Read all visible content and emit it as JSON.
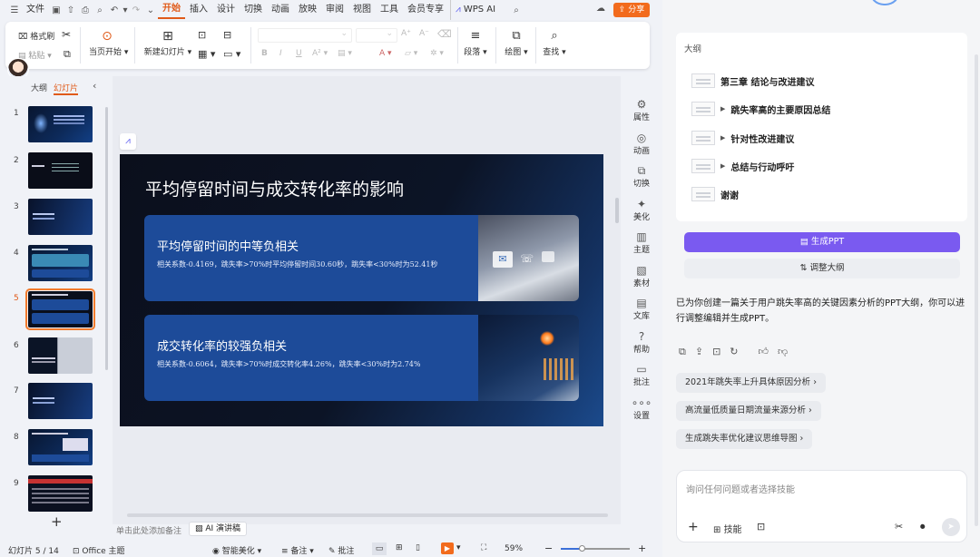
{
  "app": {
    "file_menu": "文件",
    "ribbon_tabs": [
      "开始",
      "插入",
      "设计",
      "切换",
      "动画",
      "放映",
      "审阅",
      "视图",
      "工具",
      "会员专享"
    ],
    "wps_ai": "WPS AI",
    "share": "分享"
  },
  "ribbon": {
    "format_painter": "格式刷",
    "paste": "粘贴",
    "start_from_current": "当页开始",
    "new_slide": "新建幻灯片",
    "paragraph": "段落",
    "drawing": "绘图",
    "find": "查找",
    "accent_color": "#e05a19"
  },
  "left_panel": {
    "tab_outline": "大纲",
    "tab_slides": "幻灯片",
    "slide_numbers": [
      "1",
      "2",
      "3",
      "4",
      "5",
      "6",
      "7",
      "8",
      "9"
    ],
    "selected_slide": 5,
    "add_slide": "+"
  },
  "slide": {
    "title": "平均停留时间与成交转化率的影响",
    "cards": [
      {
        "heading": "平均停留时间的中等负相关",
        "text": "相关系数-0.4169，跳失率>70%时平均停留时间30.60秒，跳失率<30%时为52.41秒"
      },
      {
        "heading": "成交转化率的较强负相关",
        "text": "相关系数-0.6064，跳失率>70%时成交转化率4.26%，跳失率<30%时为2.74%"
      }
    ]
  },
  "right_tools": [
    "属性",
    "动画",
    "切换",
    "美化",
    "主题",
    "素材",
    "文库",
    "帮助",
    "批注",
    "设置"
  ],
  "notes": {
    "placeholder": "单击此处添加备注",
    "ai_script": "AI 演讲稿"
  },
  "status_bar": {
    "slide_position": "幻灯片 5 / 14",
    "theme": "Office 主题",
    "smart_beautify": "智能美化",
    "notes": "备注",
    "comments": "批注",
    "zoom": "59%"
  },
  "ai_panel": {
    "outline_title": "大纲",
    "outline_items": [
      {
        "label": "第三章 结论与改进建议",
        "has_arrow": false
      },
      {
        "label": "跳失率高的主要原因总结",
        "has_arrow": true
      },
      {
        "label": "针对性改进建议",
        "has_arrow": true
      },
      {
        "label": "总结与行动呼吁",
        "has_arrow": true
      },
      {
        "label": "谢谢",
        "has_arrow": false
      }
    ],
    "generate_button": "生成PPT",
    "adjust_button": "调整大纲",
    "message": "已为你创建一篇关于用户跳失率高的关键因素分析的PPT大纲，你可以进行调整编辑并生成PPT。",
    "suggestions": [
      "2021年跳失率上升具体原因分析",
      "高流量低质量日期流量来源分析",
      "生成跳失率优化建议思维导图"
    ],
    "input_placeholder": "询问任何问题或者选择技能",
    "skills_label": "技能",
    "primary_color": "#7a5af0"
  }
}
